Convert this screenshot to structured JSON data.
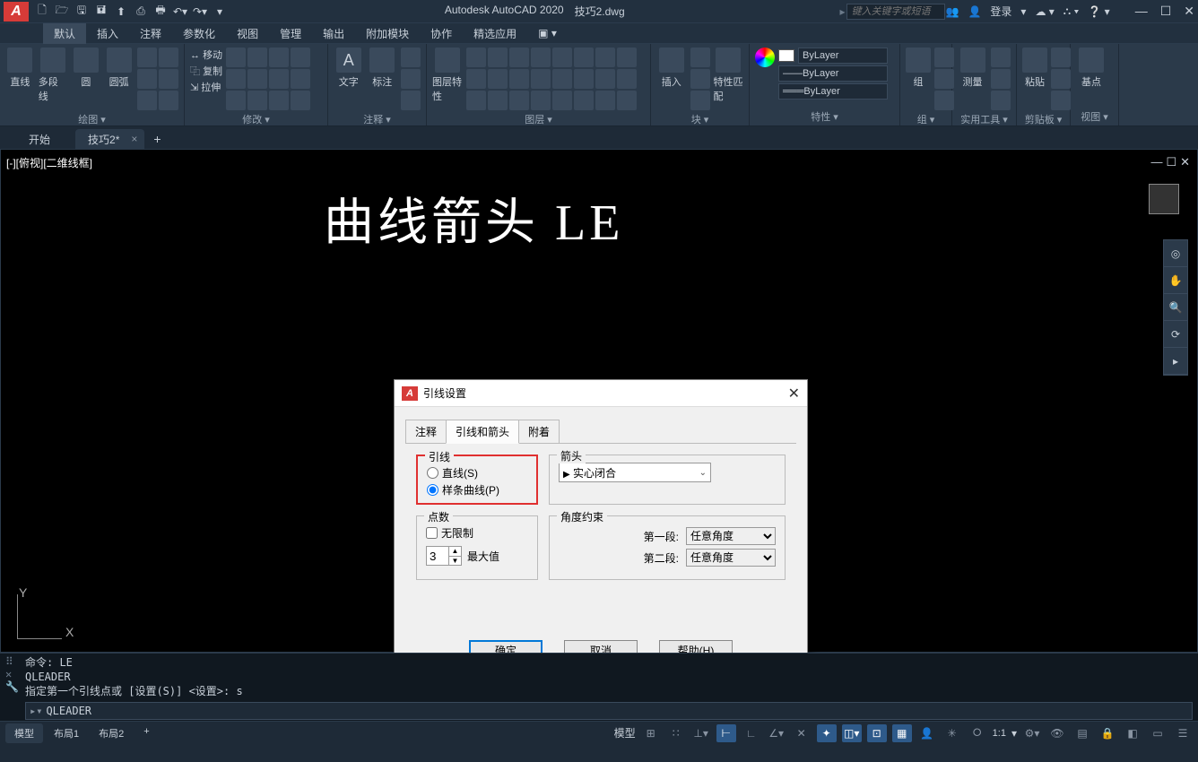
{
  "app": {
    "name": "Autodesk AutoCAD 2020",
    "doc": "技巧2.dwg",
    "logo": "A"
  },
  "search": {
    "placeholder": "键入关键字或短语"
  },
  "login": {
    "label": "登录"
  },
  "menus": [
    "默认",
    "插入",
    "注释",
    "参数化",
    "视图",
    "管理",
    "输出",
    "附加模块",
    "协作",
    "精选应用"
  ],
  "ribbon": {
    "panels": {
      "draw": "绘图",
      "modify": "修改",
      "annot": "注释",
      "layer": "图层",
      "block": "块",
      "props": "特性",
      "group": "组",
      "util": "实用工具",
      "clip": "剪贴板",
      "view": "视图"
    },
    "draw_btns": {
      "line": "直线",
      "pline": "多段线",
      "circle": "圆",
      "arc": "圆弧"
    },
    "modify_labels": {
      "move": "移动",
      "copy": "复制",
      "stretch": "拉伸"
    },
    "annot_btns": {
      "text": "文字",
      "dim": "标注"
    },
    "layer_btn": "图层特性",
    "block_btns": {
      "insert": "插入",
      "match": "特性匹配"
    },
    "props_layer": "ByLayer",
    "group_btn": "组",
    "util_btn": "测量",
    "clip_btn": "粘贴",
    "view_btn": "基点"
  },
  "filetabs": {
    "start": "开始",
    "file": "技巧2*"
  },
  "viewport": {
    "label": "[-][俯视][二维线框]"
  },
  "canvas_text": "曲线箭头   LE",
  "ucs": {
    "x": "X",
    "y": "Y"
  },
  "cmd": {
    "lines": [
      "命令: LE",
      "QLEADER",
      "指定第一个引线点或 [设置(S)] <设置>: s"
    ],
    "current": "QLEADER"
  },
  "layouts": {
    "model": "模型",
    "l1": "布局1",
    "l2": "布局2"
  },
  "status": {
    "model": "模型",
    "scale": "1:1"
  },
  "dialog": {
    "title": "引线设置",
    "tabs": {
      "annot": "注释",
      "leader": "引线和箭头",
      "attach": "附着"
    },
    "leader": {
      "legend": "引线",
      "straight": "直线(S)",
      "spline": "样条曲线(P)"
    },
    "arrow": {
      "legend": "箭头",
      "value": "实心闭合"
    },
    "points": {
      "legend": "点数",
      "unlimited": "无限制",
      "max": "最大值",
      "value": "3"
    },
    "angle": {
      "legend": "角度约束",
      "seg1": "第一段:",
      "seg2": "第二段:",
      "any": "任意角度"
    },
    "buttons": {
      "ok": "确定",
      "cancel": "取消",
      "help": "帮助(H)"
    }
  }
}
